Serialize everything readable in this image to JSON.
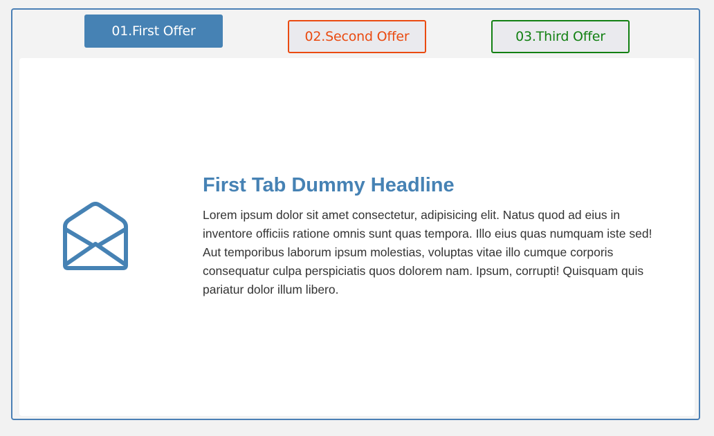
{
  "tabs": [
    {
      "label": "01.First Offer",
      "color": "#ffffff",
      "background": "#4682b4",
      "active": true
    },
    {
      "label": "02.Second Offer",
      "color": "#ea4a10",
      "active": false
    },
    {
      "label": "03.Third Offer",
      "color": "#128012",
      "active": false
    }
  ],
  "panel": {
    "icon": "envelope-open-icon",
    "icon_color": "#4682b4",
    "headline": "First Tab Dummy Headline",
    "body": "Lorem ipsum dolor sit amet consectetur, adipisicing elit. Natus quod ad eius in inventore officiis ratione omnis sunt quas tempora. Illo eius quas numquam iste sed! Aut temporibus laborum ipsum molestias, voluptas vitae illo cumque corporis consequatur culpa perspiciatis quos dolorem nam. Ipsum, corrupti! Quisquam quis pariatur dolor illum libero."
  },
  "colors": {
    "accent": "#4682b4",
    "frame_border": "#4a7fb5",
    "text": "#333333"
  }
}
